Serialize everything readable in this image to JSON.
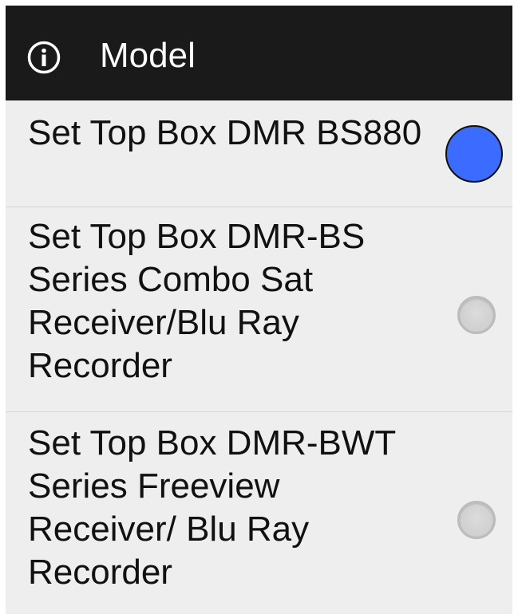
{
  "dialog": {
    "title": "Model",
    "title_icon": "info-icon"
  },
  "options": [
    {
      "label": "Set Top Box DMR BS880",
      "selected": true
    },
    {
      "label": "Set Top Box DMR-BS Series Combo Sat Receiver/Blu Ray Recorder",
      "selected": false
    },
    {
      "label": "Set Top Box DMR-BWT Series Freeview Receiver/ Blu Ray Recorder",
      "selected": false
    }
  ],
  "colors": {
    "title_bar": "#1a1a1a",
    "list_background": "#eeeeee",
    "radio_selected": "#3b6cff"
  }
}
